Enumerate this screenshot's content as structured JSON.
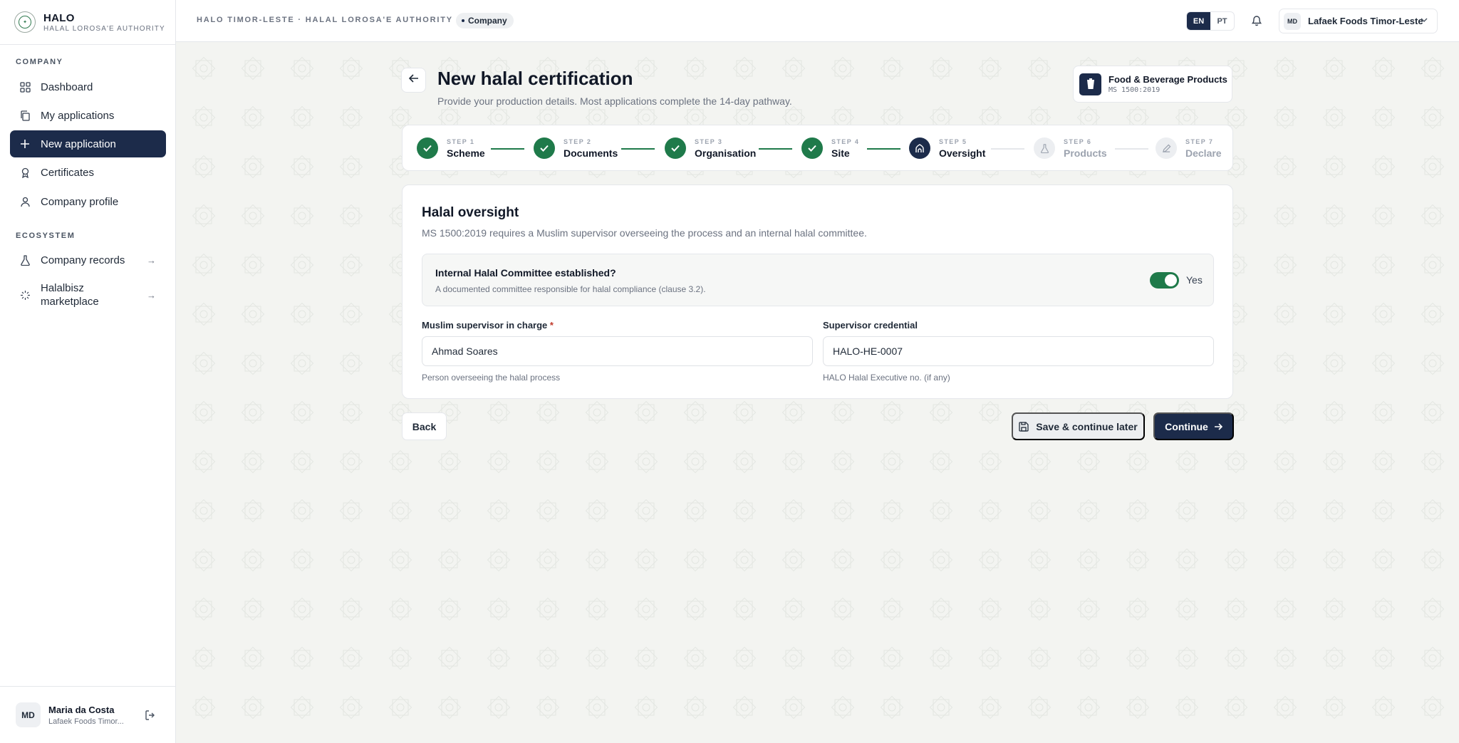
{
  "brand": {
    "name": "HALO",
    "subtitle": "HALAL LOROSA'E AUTHORITY"
  },
  "sidebar": {
    "section_company": "COMPANY",
    "section_ecosystem": "ECOSYSTEM",
    "items": [
      {
        "label": "Dashboard",
        "icon": "grid-icon"
      },
      {
        "label": "My applications",
        "icon": "copy-icon"
      },
      {
        "label": "New application",
        "icon": "plus-icon",
        "active": true
      },
      {
        "label": "Certificates",
        "icon": "award-icon"
      },
      {
        "label": "Company profile",
        "icon": "user-icon"
      }
    ],
    "ecosystem_items": [
      {
        "label": "Company records",
        "icon": "flask-icon"
      },
      {
        "label": "Halalbisz marketplace",
        "icon": "sparkle-icon"
      }
    ]
  },
  "user": {
    "initials": "MD",
    "name": "Maria da Costa",
    "org": "Lafaek Foods Timor..."
  },
  "topbar": {
    "breadcrumb": "HALO TIMOR-LESTE · HALAL LOROSA'E AUTHORITY",
    "role_pill": "Company",
    "lang_en": "EN",
    "lang_pt": "PT",
    "org_initials": "MD",
    "org_name": "Lafaek Foods Timor-Leste"
  },
  "page": {
    "title": "New halal certification",
    "subtitle": "Provide your production details. Most applications complete the 14-day pathway."
  },
  "scheme": {
    "name": "Food & Beverage Products",
    "code": "MS 1500:2019"
  },
  "steps": [
    {
      "step": "STEP 1",
      "name": "Scheme",
      "state": "done"
    },
    {
      "step": "STEP 2",
      "name": "Documents",
      "state": "done"
    },
    {
      "step": "STEP 3",
      "name": "Organisation",
      "state": "done"
    },
    {
      "step": "STEP 4",
      "name": "Site",
      "state": "done"
    },
    {
      "step": "STEP 5",
      "name": "Oversight",
      "state": "current"
    },
    {
      "step": "STEP 6",
      "name": "Products",
      "state": "pending"
    },
    {
      "step": "STEP 7",
      "name": "Declare",
      "state": "pending"
    }
  ],
  "oversight": {
    "title": "Halal oversight",
    "description": "MS 1500:2019 requires a Muslim supervisor overseeing the process and an internal halal committee.",
    "committee_question": "Internal Halal Committee established?",
    "committee_help": "A documented committee responsible for halal compliance (clause 3.2).",
    "committee_value": "Yes",
    "supervisor_label": "Muslim supervisor in charge",
    "supervisor_required": "*",
    "supervisor_value": "Ahmad Soares",
    "supervisor_help": "Person overseeing the halal process",
    "credential_label": "Supervisor credential",
    "credential_value": "HALO-HE-0007",
    "credential_help": "HALO Halal Executive no. (if any)"
  },
  "actions": {
    "back": "Back",
    "save_later": "Save & continue later",
    "continue": "Continue"
  },
  "colors": {
    "navy": "#1c2b4a",
    "green": "#1f7a4a",
    "background": "#f3f4f1"
  }
}
